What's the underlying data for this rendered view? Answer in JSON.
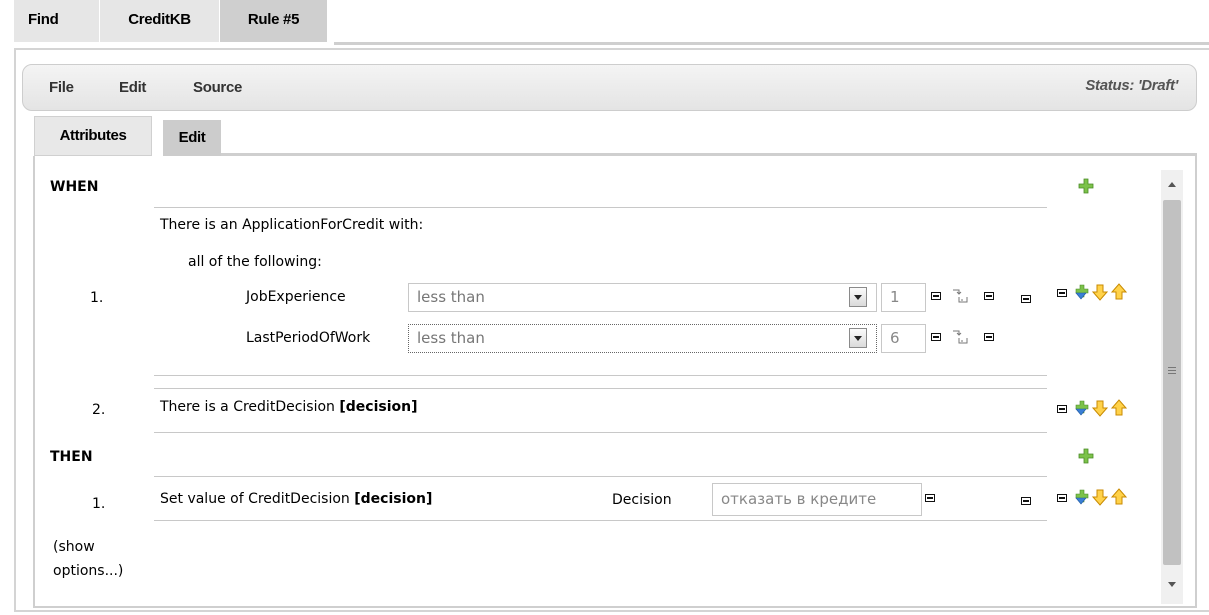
{
  "top_tabs": [
    "Find",
    "CreditKB",
    "Rule #5"
  ],
  "menu": {
    "file": "File",
    "edit": "Edit",
    "source": "Source",
    "status": "Status: 'Draft'"
  },
  "sub_tabs": {
    "attributes": "Attributes",
    "edit": "Edit"
  },
  "rule": {
    "when_label": "WHEN",
    "then_label": "THEN",
    "conditions": [
      {
        "number": "1.",
        "text": "There is an ApplicationForCredit with:",
        "group": "all of the following:",
        "constraints": [
          {
            "field": "JobExperience",
            "operator": "less than",
            "value": "1"
          },
          {
            "field": "LastPeriodOfWork",
            "operator": "less than",
            "value": "6"
          }
        ]
      },
      {
        "number": "2.",
        "text": "There is a CreditDecision",
        "binding": "[decision]"
      }
    ],
    "actions": [
      {
        "number": "1.",
        "text": "Set value of CreditDecision",
        "binding": "[decision]",
        "field": "Decision",
        "value": "отказать в кредите"
      }
    ],
    "show_options": "(show options...)",
    "show_options_line1": "(show",
    "show_options_line2": "options...)"
  },
  "icons": {
    "add": "green-plus-icon",
    "insert": "insert-row-icon",
    "move_down": "arrow-down-icon",
    "move_up": "arrow-up-icon",
    "remove": "remove-square-icon",
    "field_binding": "field-binding-icon"
  }
}
